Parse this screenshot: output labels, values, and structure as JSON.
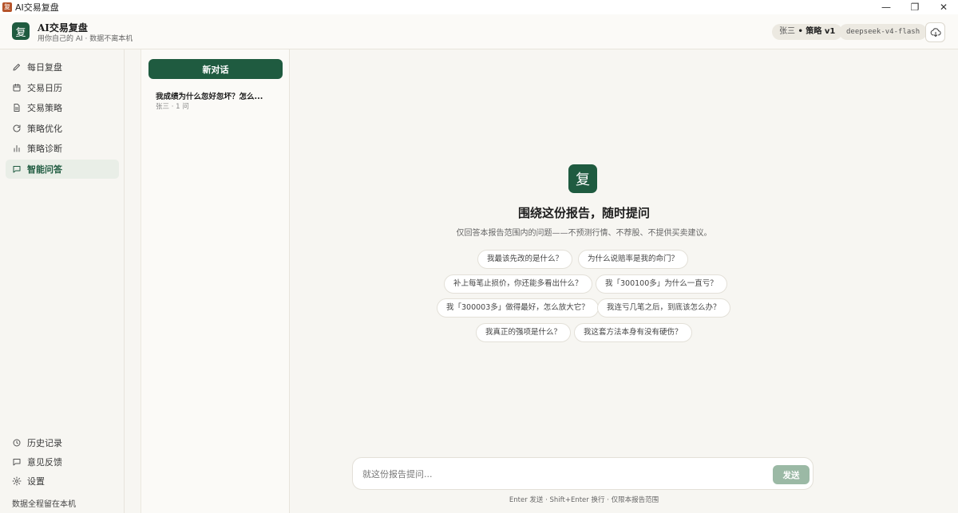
{
  "window": {
    "title": "AI交易复盘",
    "icon_glyph": "复",
    "controls": {
      "minimize": "—",
      "restore": "❐",
      "close": "✕"
    }
  },
  "header": {
    "logo_glyph": "复",
    "brand_title": "AI交易复盘",
    "brand_subtitle": "用你自己的 AI · 数据不离本机",
    "user_name": "张三",
    "user_sep": " • ",
    "strategy": "策略 v1",
    "model": "deepseek-v4-flash",
    "cloud_icon": "cloud-download-icon"
  },
  "sidebar": {
    "items": [
      {
        "label": "每日复盘",
        "icon": "pencil-icon"
      },
      {
        "label": "交易日历",
        "icon": "calendar-icon"
      },
      {
        "label": "交易策略",
        "icon": "document-icon"
      },
      {
        "label": "策略优化",
        "icon": "refresh-icon"
      },
      {
        "label": "策略诊断",
        "icon": "bar-chart-icon"
      },
      {
        "label": "智能问答",
        "icon": "chat-icon",
        "active": true
      }
    ],
    "bottom_items": [
      {
        "label": "历史记录",
        "icon": "clock-icon"
      },
      {
        "label": "意见反馈",
        "icon": "chat-icon"
      },
      {
        "label": "设置",
        "icon": "gear-icon"
      }
    ],
    "footer_note": "数据全程留在本机"
  },
  "conversations": {
    "new_label": "新对话",
    "items": [
      {
        "title": "我成绩为什么忽好忽坏？怎么...",
        "meta": "张三 · 1 问"
      }
    ]
  },
  "main": {
    "logo_glyph": "复",
    "title": "围绕这份报告，随时提问",
    "subtitle": "仅回答本报告范围内的问题——不预测行情、不荐股、不提供买卖建议。",
    "suggestions": [
      "我最该先改的是什么？",
      "为什么说赔率是我的命门？",
      "补上每笔止损价，你还能多看出什么？",
      "我「300100多」为什么一直亏？",
      "我「300003多」做得最好，怎么放大它？",
      "我连亏几笔之后，到底该怎么办？",
      "我真正的强项是什么？",
      "我这套方法本身有没有硬伤？"
    ],
    "composer": {
      "placeholder": "就这份报告提问...",
      "send_label": "发送"
    },
    "hint": "Enter 发送 · Shift+Enter 换行 · 仅限本报告范围"
  },
  "colors": {
    "brand_green": "#1f5b40",
    "send_disabled": "#9bb9a5",
    "app_icon": "#b5532a"
  }
}
